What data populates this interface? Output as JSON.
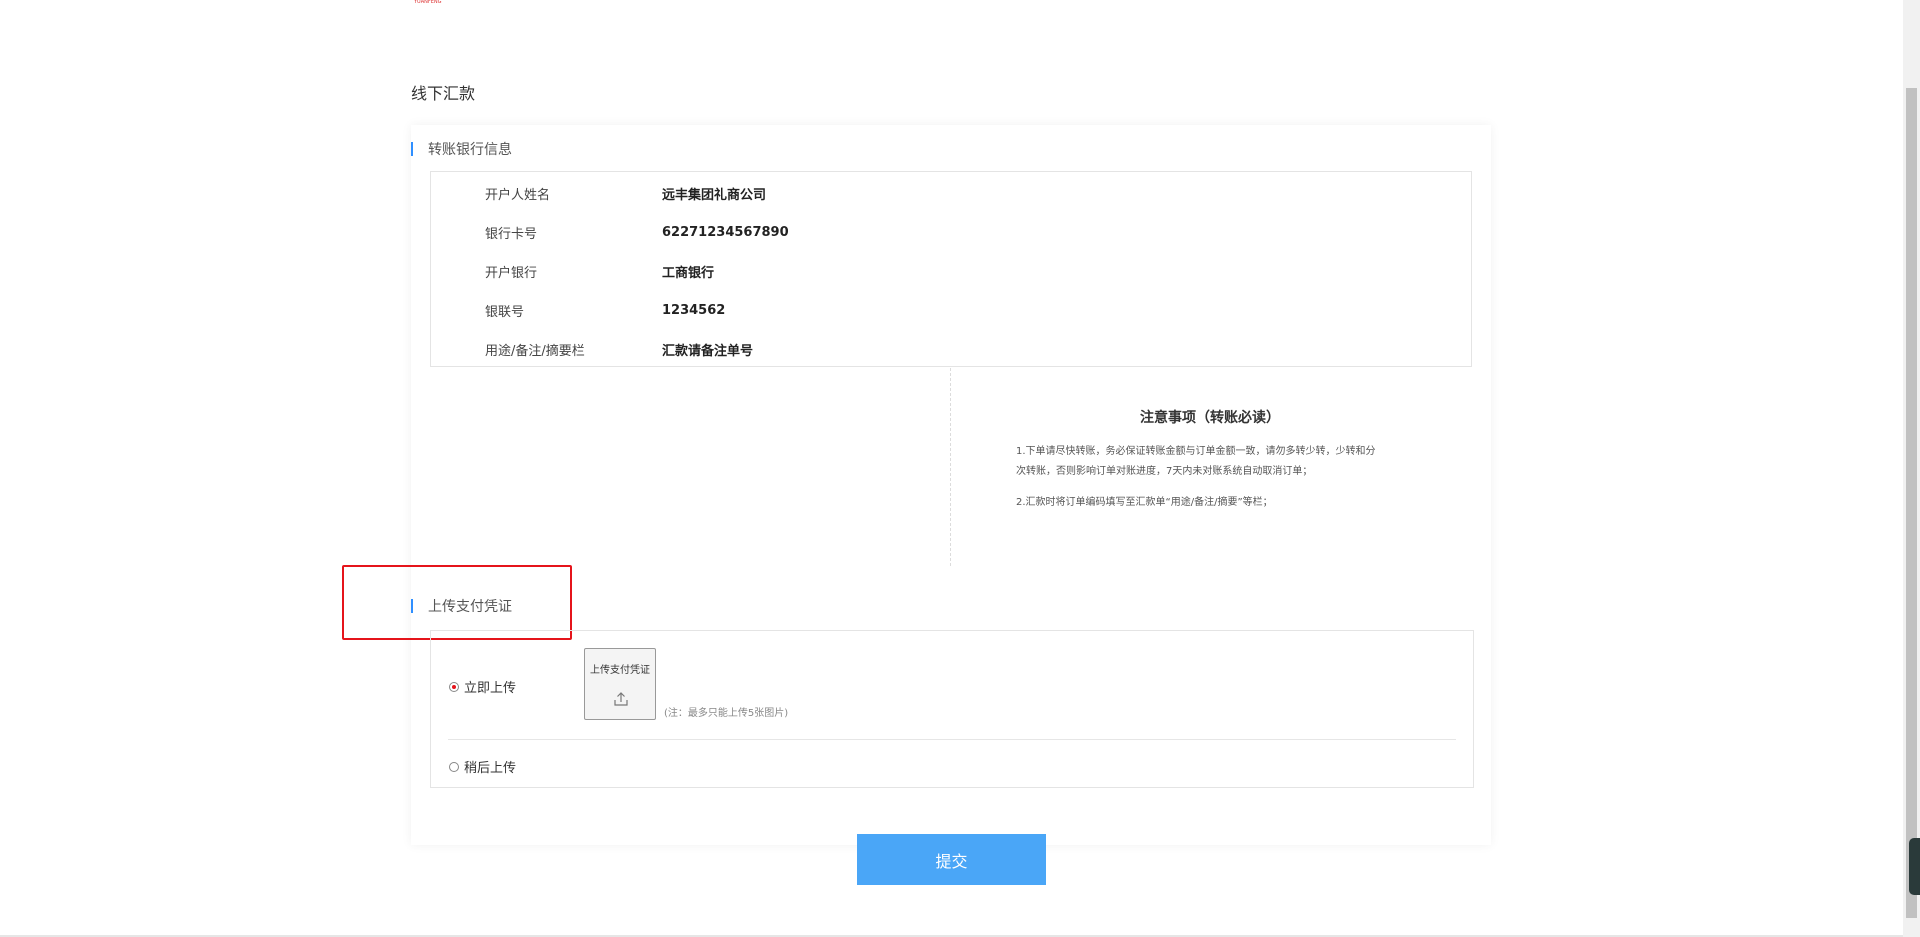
{
  "logo_text": "YUANFENG",
  "page_title": "线下汇款",
  "bank_section": {
    "title": "转账银行信息",
    "rows": [
      {
        "label": "开户人姓名",
        "value": "远丰集团礼商公司"
      },
      {
        "label": "银行卡号",
        "value": "62271234567890"
      },
      {
        "label": "开户银行",
        "value": "工商银行"
      },
      {
        "label": "银联号",
        "value": "1234562"
      },
      {
        "label": "用途/备注/摘要栏",
        "value": "汇款请备注单号"
      }
    ]
  },
  "notice": {
    "title": "注意事项（转账必读）",
    "line1a": "1.下单请尽快转账，务必保证转账金额与订单金额一致，请勿多转少转，少转和分",
    "line1b": "次转账，否则影响订单对账进度，7天内未对账系统自动取消订单；",
    "line2": "2.汇款时将订单编码填写至汇款单“用途/备注/摘要”等栏；"
  },
  "upload_section": {
    "title": "上传支付凭证",
    "option_now": "立即上传",
    "option_later": "稍后上传",
    "selected": "立即上传",
    "upload_button_label": "上传支付凭证",
    "note": "(注：最多只能上传5张图片)"
  },
  "submit_label": "提交",
  "colors": {
    "accent": "#2f8fff",
    "submit": "#4aa6f7",
    "highlight": "#e5141b"
  }
}
